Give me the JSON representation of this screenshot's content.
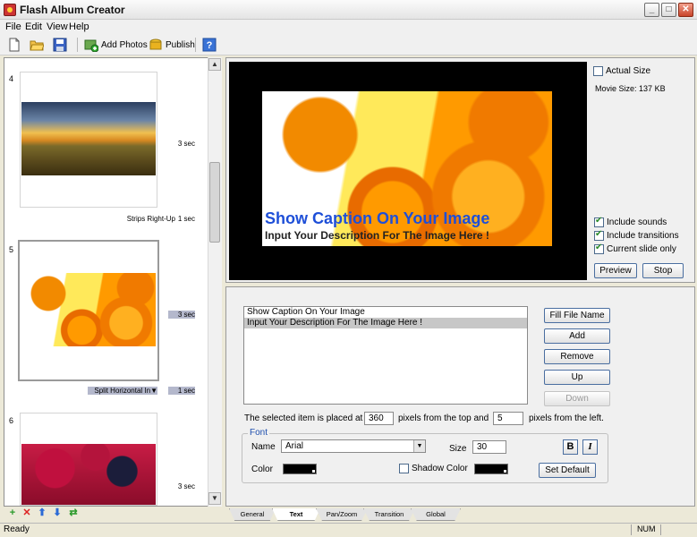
{
  "window": {
    "title": "Flash Album Creator"
  },
  "menu": [
    "File",
    "Edit",
    "View",
    "Help"
  ],
  "toolbar": {
    "add_photos": "Add Photos",
    "publish": "Publish"
  },
  "slides": [
    {
      "num": "4",
      "duration": "3 sec",
      "transition": "Strips Right-Up",
      "transition_duration": "1 sec"
    },
    {
      "num": "5",
      "duration": "3 sec",
      "transition": "Split Horizontal In▼",
      "transition_duration": "1 sec"
    },
    {
      "num": "6",
      "duration": "3 sec"
    }
  ],
  "preview": {
    "caption_title": "Show Caption On Your Image",
    "caption_desc": "Input Your Description For The Image Here !",
    "actual_size": "Actual Size",
    "movie_size_label": "Movie Size:",
    "movie_size_value": "137 KB",
    "include_sounds": "Include sounds",
    "include_transitions": "Include transitions",
    "current_slide_only": "Current slide only",
    "preview_btn": "Preview",
    "stop_btn": "Stop"
  },
  "text_panel": {
    "items": [
      "Show Caption On Your Image",
      "Input Your Description For The Image Here !"
    ],
    "fill_file_name": "Fill File Name",
    "add": "Add",
    "remove": "Remove",
    "up": "Up",
    "down": "Down",
    "placed_prefix": "The selected item is placed at",
    "top_value": "360",
    "placed_mid": "pixels from the top and",
    "left_value": "5",
    "placed_suffix": "pixels from the left.",
    "font_legend": "Font",
    "name_label": "Name",
    "font_name": "Arial",
    "size_label": "Size",
    "font_size": "30",
    "bold": "B",
    "italic": "I",
    "color_label": "Color",
    "shadow_color": "Shadow Color",
    "set_default": "Set Default"
  },
  "tabs": [
    "General",
    "Text",
    "Pan/Zoom",
    "Transition",
    "Global"
  ],
  "status": {
    "text": "Ready",
    "num": "NUM"
  }
}
